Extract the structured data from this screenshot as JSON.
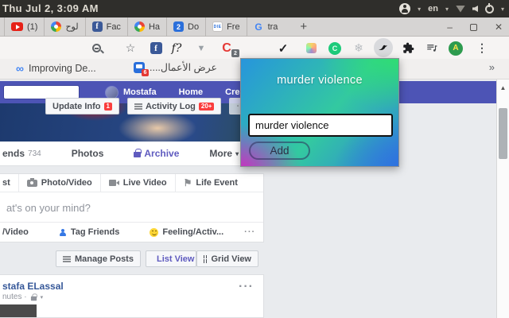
{
  "system_bar": {
    "clock": "Thu Jul 2, 3:09 AM",
    "language": "en",
    "caret": "▾"
  },
  "tab_strip": {
    "tabs": [
      {
        "label": "(1)",
        "icon": "youtube-icon"
      },
      {
        "label": "لوح",
        "icon": "color-wheel-icon"
      },
      {
        "label": "Fac",
        "icon": "facebook-icon",
        "icon_text": "f"
      },
      {
        "label": "Ha",
        "icon": "pinwheel-icon"
      },
      {
        "label": "Do",
        "icon": "blue-two-icon",
        "icon_text": "2"
      },
      {
        "label": "Fre",
        "icon": "die-icon",
        "icon_text": "DIE"
      },
      {
        "label": "tra",
        "icon": "google-g-icon",
        "icon_text": "G"
      }
    ],
    "new_tab": "+",
    "window_controls": {
      "minimize": "–",
      "close": "✕"
    }
  },
  "toolbar": {
    "star": "☆",
    "fb_letter": "f",
    "fq_label": "f?",
    "chevron": "▼",
    "c_red_letter": "C",
    "c_red_badge": "2",
    "cloud": "☁",
    "check": "✓",
    "green_c_letter": "C",
    "snowflake": "❄",
    "avatar_letter": "A",
    "kebab": "⋮"
  },
  "bookmarks_bar": {
    "item1_label": "Improving De...",
    "item1_icon": "∞",
    "item2_label": "عرض الأعمال....",
    "item2_badge": "6",
    "overflow": "»"
  },
  "facebook": {
    "navbar": {
      "profile_name": "Mostafa",
      "home_label": "Home",
      "create_label": "Create"
    },
    "cover_buttons": {
      "update_info": "Update Info",
      "update_info_badge": "1",
      "activity_log": "Activity Log",
      "activity_log_badge": "20+",
      "more": "···"
    },
    "profile_tabs": {
      "friends": "ends",
      "friends_count": "734",
      "photos": "Photos",
      "archive": "Archive",
      "more": "More",
      "more_caret": "▾"
    },
    "composer": {
      "create_post": "st",
      "photo_video": "Photo/Video",
      "live_video": "Live Video",
      "life_event": "Life Event",
      "flag": "⚑",
      "prompt": "at's on your mind?",
      "photo_video2": "/Video",
      "tag_friends": "Tag Friends",
      "feeling": "Feeling/Activ...",
      "more": "···"
    },
    "manage_row": {
      "manage_posts": "Manage Posts",
      "list_view": "List View",
      "grid_view": "Grid View"
    },
    "post": {
      "author": "stafa ELassal",
      "meta": "nutes ·",
      "meta_caret": "▾",
      "more": "···"
    },
    "scroll_up": "▲"
  },
  "popup": {
    "title": "murder violence",
    "input_value": "murder violence",
    "add_label": "Add"
  },
  "colors": {
    "navbar": "#4d54b5",
    "popup_green": "#2fe06e",
    "popup_magenta": "#d428c0",
    "popup_blue": "#2795dc",
    "badge_red": "#fa3e3e"
  }
}
